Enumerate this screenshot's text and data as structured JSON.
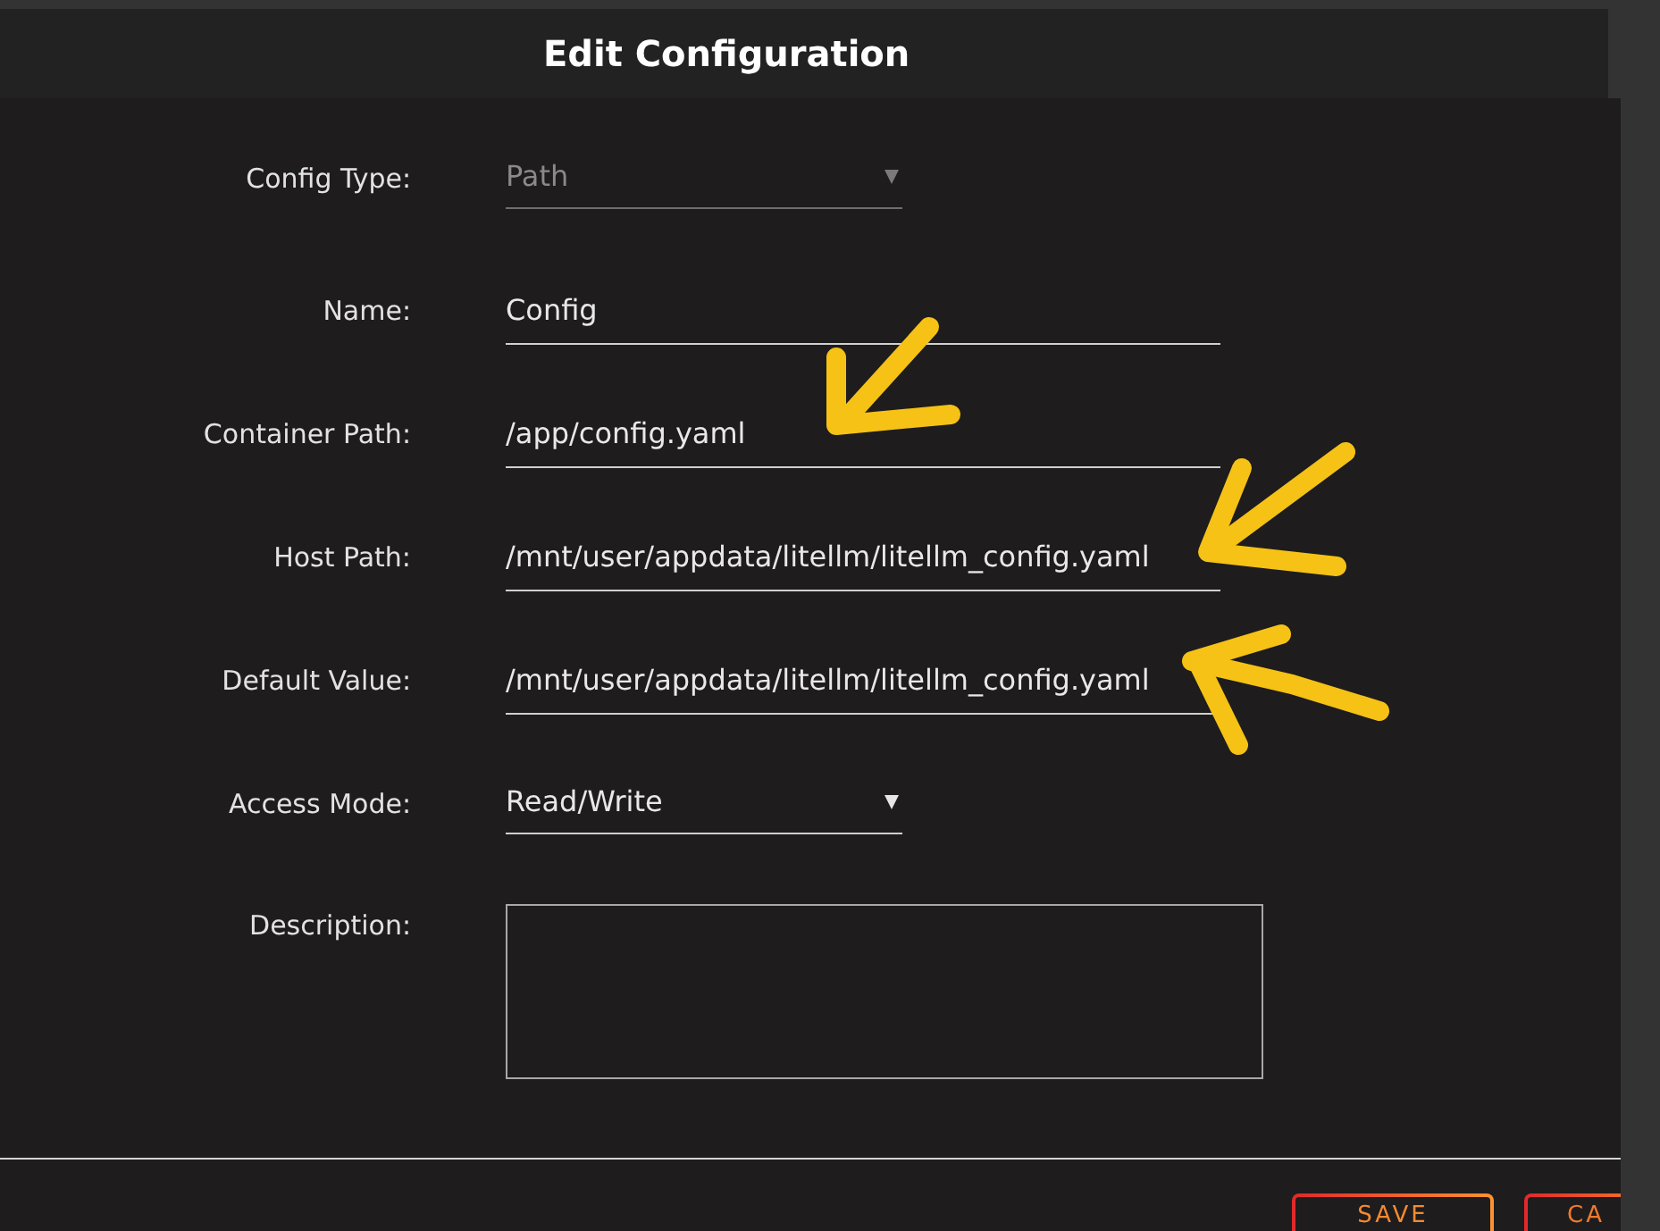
{
  "dialog": {
    "title": "Edit Configuration"
  },
  "fields": [
    {
      "kind": "select",
      "label": "Config Type:",
      "value": "Path",
      "disabled": true,
      "marked": false
    },
    {
      "kind": "text",
      "label": "Name:",
      "value": "Config",
      "disabled": false,
      "marked": false
    },
    {
      "kind": "text",
      "label": "Container Path:",
      "value": "/app/config.yaml",
      "disabled": false,
      "marked": true
    },
    {
      "kind": "text",
      "label": "Host Path:",
      "value": "/mnt/user/appdata/litellm/litellm_config.yaml",
      "disabled": false,
      "marked": true
    },
    {
      "kind": "text",
      "label": "Default Value:",
      "value": "/mnt/user/appdata/litellm/litellm_config.yaml",
      "disabled": false,
      "marked": true
    },
    {
      "kind": "select",
      "label": "Access Mode:",
      "value": "Read/Write",
      "disabled": false,
      "marked": false
    },
    {
      "kind": "textarea",
      "label": "Description:",
      "disabled": false,
      "marked": false
    }
  ],
  "buttons": [
    {
      "label": "SAVE"
    },
    {
      "label": "CA"
    }
  ]
}
